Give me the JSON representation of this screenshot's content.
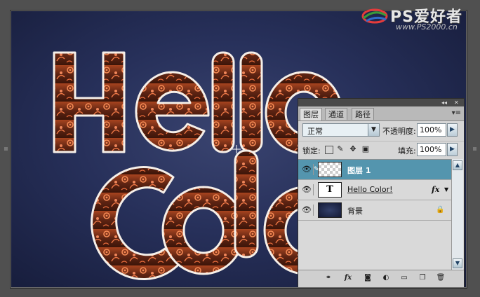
{
  "watermark": {
    "brand": "PS爱好者",
    "site": "www.PS2000.cn"
  },
  "artwork": {
    "line1": "Hello",
    "line2": "Color"
  },
  "colors": {
    "canvas_bg": "#27305a",
    "letter_fill": "#6a2a14",
    "letter_glow": "#f27a45",
    "letter_outline": "#f3ece6",
    "selected_layer": "#5495ae"
  },
  "layers_panel": {
    "tabs": [
      {
        "label": "图层"
      },
      {
        "label": "通道"
      },
      {
        "label": "路径"
      }
    ],
    "blend_mode": "正常",
    "opacity_label": "不透明度:",
    "opacity_value": "100%",
    "lock_label": "锁定:",
    "fill_label": "填充:",
    "fill_value": "100%",
    "layers": [
      {
        "name": "图层 1",
        "visible": true,
        "selected": true,
        "thumb": "transparent"
      },
      {
        "name": "Hello Color!",
        "visible": true,
        "selected": false,
        "thumb": "T",
        "has_fx": true,
        "fx_label": "fx"
      },
      {
        "name": "背景",
        "visible": true,
        "selected": false,
        "thumb": "background",
        "locked": true
      }
    ],
    "icons": {
      "eye": "eye-icon",
      "link": "link-layers-icon",
      "fx": "fx-icon",
      "mask": "add-mask-icon",
      "adjust": "adjustment-layer-icon",
      "group": "new-group-icon",
      "new": "new-layer-icon",
      "trash": "trash-icon"
    }
  }
}
